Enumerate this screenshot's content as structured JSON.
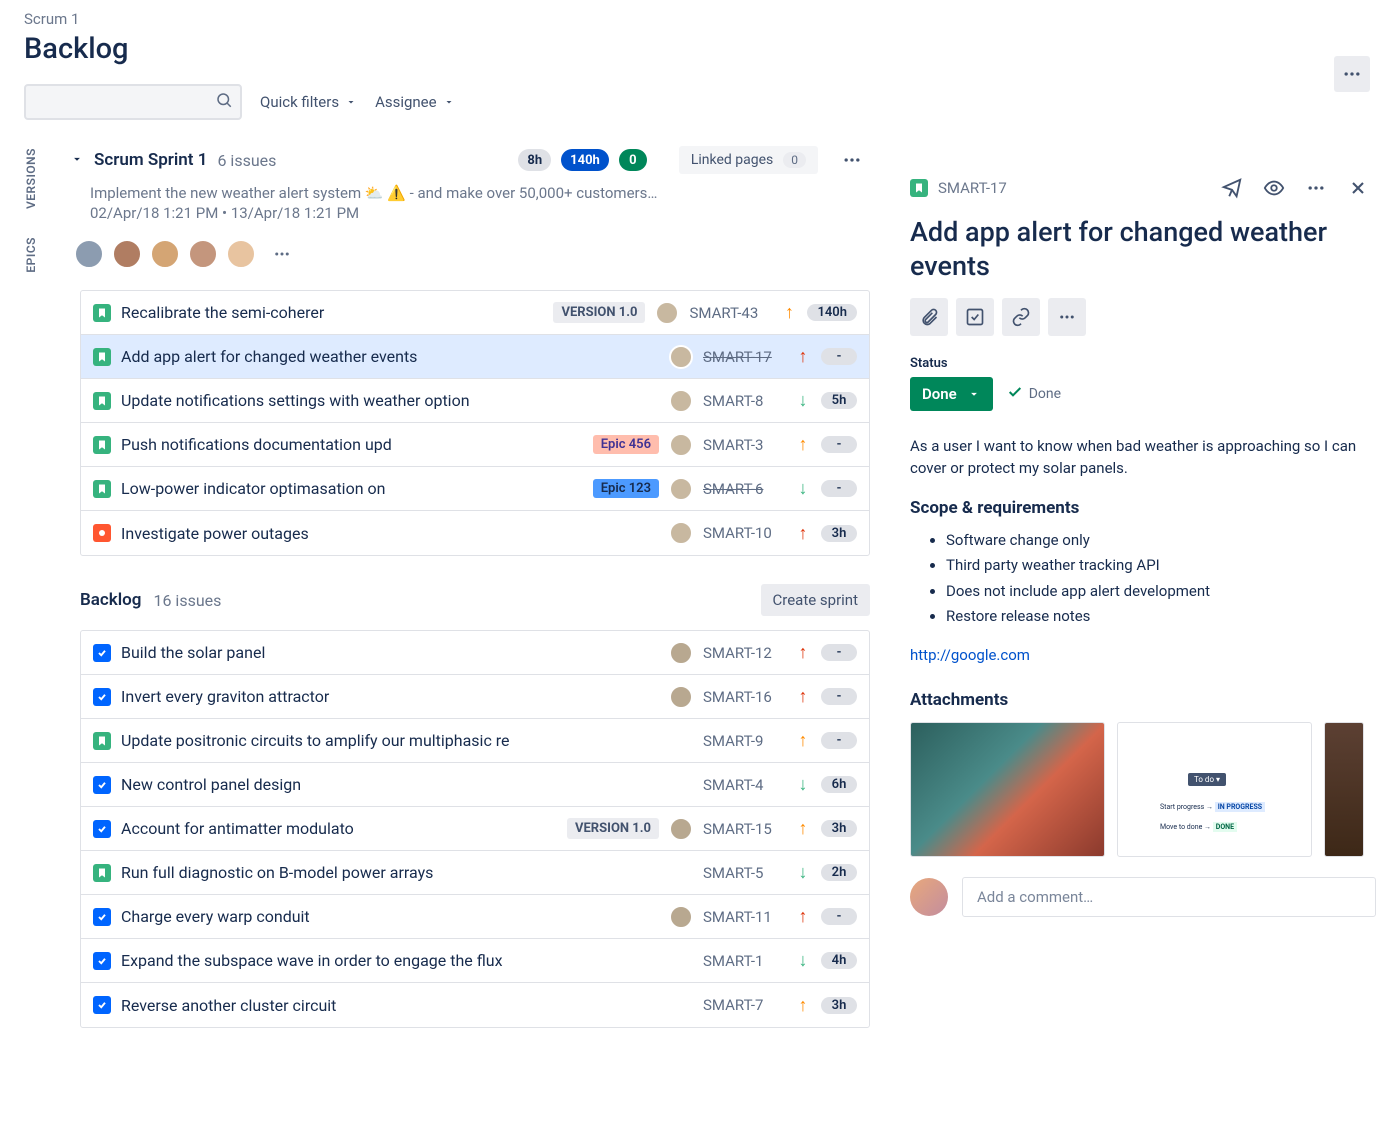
{
  "breadcrumb": "Scrum 1",
  "page_title": "Backlog",
  "toolbar": {
    "search_placeholder": "",
    "quick_filters": "Quick filters",
    "assignee": "Assignee"
  },
  "side_tabs": {
    "versions": "VERSIONS",
    "epics": "EPICS"
  },
  "sprint": {
    "name": "Scrum Sprint 1",
    "count_label": "6 issues",
    "estimates": {
      "grey": "8h",
      "blue": "140h",
      "green": "0"
    },
    "linked_pages_label": "Linked pages",
    "linked_pages_count": "0",
    "goal": "Implement the new weather alert system ⛅ ⚠️ - and make over 50,000+ customers…",
    "dates": "02/Apr/18 1:21 PM • 13/Apr/18 1:21 PM"
  },
  "sprint_issues": [
    {
      "type": "story",
      "summary": "Recalibrate the semi-coherer",
      "version": "VERSION 1.0",
      "key": "SMART-43",
      "prio": "up-orange",
      "est": "140h"
    },
    {
      "type": "story",
      "summary": "Add app alert for changed weather events",
      "key": "SMART-17",
      "struck": true,
      "prio": "up-red",
      "est": "-",
      "selected": true
    },
    {
      "type": "story",
      "summary": "Update notifications settings with weather option",
      "key": "SMART-8",
      "prio": "down-green",
      "est": "5h"
    },
    {
      "type": "story",
      "summary": "Push notifications documentation upd",
      "epic": {
        "label": "Epic 456",
        "bg": "#FFBDAD",
        "fg": "#403294"
      },
      "key": "SMART-3",
      "prio": "up-orange",
      "est": "-"
    },
    {
      "type": "story",
      "summary": "Low-power indicator optimasation on",
      "epic": {
        "label": "Epic 123",
        "bg": "#4C9AFF",
        "fg": "#172B4D"
      },
      "key": "SMART-6",
      "struck": true,
      "prio": "down-green",
      "est": "-"
    },
    {
      "type": "bug",
      "summary": "Investigate power outages",
      "key": "SMART-10",
      "prio": "up-red",
      "est": "3h"
    }
  ],
  "backlog": {
    "title": "Backlog",
    "count_label": "16 issues",
    "create_sprint": "Create sprint"
  },
  "backlog_issues": [
    {
      "type": "task",
      "summary": "Build the solar panel",
      "key": "SMART-12",
      "prio": "up-red",
      "est": "-",
      "assignee": true
    },
    {
      "type": "task",
      "summary": "Invert every graviton attractor",
      "key": "SMART-16",
      "prio": "up-red",
      "est": "-",
      "assignee": true
    },
    {
      "type": "story",
      "summary": "Update positronic circuits to amplify our multiphasic re",
      "key": "SMART-9",
      "prio": "up-orange",
      "est": "-"
    },
    {
      "type": "task",
      "summary": "New control panel design",
      "key": "SMART-4",
      "prio": "down-green",
      "est": "6h"
    },
    {
      "type": "task",
      "summary": "Account for antimatter modulato",
      "version": "VERSION 1.0",
      "key": "SMART-15",
      "prio": "up-orange",
      "est": "3h",
      "assignee": true
    },
    {
      "type": "story",
      "summary": "Run full diagnostic on B-model power arrays",
      "key": "SMART-5",
      "prio": "down-green",
      "est": "2h"
    },
    {
      "type": "task",
      "summary": "Charge every warp conduit",
      "key": "SMART-11",
      "prio": "up-red",
      "est": "-",
      "assignee": true
    },
    {
      "type": "task",
      "summary": "Expand the subspace wave in order to engage the flux",
      "key": "SMART-1",
      "prio": "down-green",
      "est": "4h"
    },
    {
      "type": "task",
      "summary": "Reverse another cluster circuit",
      "key": "SMART-7",
      "prio": "up-orange",
      "est": "3h"
    }
  ],
  "detail": {
    "key": "SMART-17",
    "title": "Add app alert for changed weather events",
    "status_label": "Status",
    "status_value": "Done",
    "status_done": "Done",
    "description": "As a user I want to know when bad weather is approaching so I can cover or protect my solar panels.",
    "scope_heading": "Scope & requirements",
    "scope_items": [
      "Software change only",
      "Third party weather tracking API",
      "Does not include app alert development",
      "Restore release notes"
    ],
    "link": "http://google.com",
    "attachments_heading": "Attachments",
    "comment_placeholder": "Add a comment…"
  }
}
